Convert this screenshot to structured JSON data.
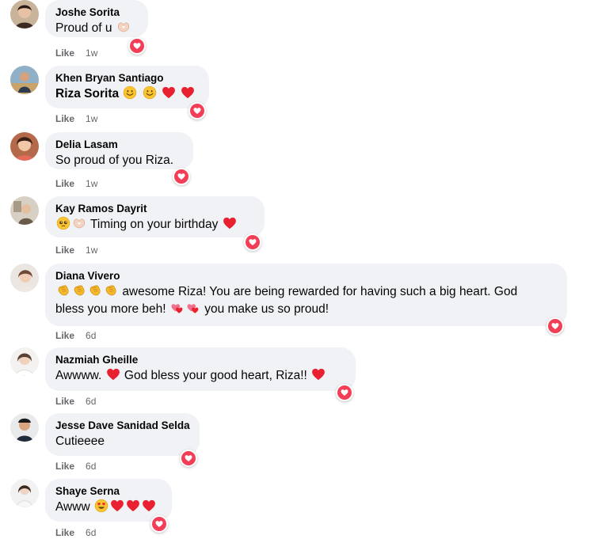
{
  "comments": [
    {
      "author": "Joshe Sorita",
      "text": "Proud of u",
      "like_label": "Like",
      "time": "1w"
    },
    {
      "author": "Khen Bryan Santiago",
      "text": "Riza Sorita",
      "like_label": "Like",
      "time": "1w"
    },
    {
      "author": "Delia Lasam",
      "text": "So proud of you Riza.",
      "like_label": "Like",
      "time": "1w"
    },
    {
      "author": "Kay Ramos Dayrit",
      "text": "Timing on your birthday",
      "like_label": "Like",
      "time": "1w"
    },
    {
      "author": "Diana Vivero",
      "text_line1": "awesome Riza! You are being rewarded for having such a big heart. God",
      "text_line2_a": "bless you more beh!",
      "text_line2_b": "you make us so proud!",
      "like_label": "Like",
      "time": "6d"
    },
    {
      "author": "Nazmiah Gheille",
      "text_a": "Awwww.",
      "text_b": "God bless your good heart, Riza!!",
      "like_label": "Like",
      "time": "6d"
    },
    {
      "author": "Jesse Dave Sanidad Selda",
      "text": "Cutieeee",
      "like_label": "Like",
      "time": "6d"
    },
    {
      "author": "Shaye Serna",
      "text": "Awww",
      "like_label": "Like",
      "time": "6d"
    }
  ],
  "icons": {
    "reaction": "heart-love-reaction-icon",
    "heart": "red-heart-emoji-icon",
    "smile": "smiling-face-emoji-icon",
    "clap": "clapping-hands-emoji-icon",
    "heart_hands": "heart-hands-emoji-icon",
    "pleading": "pleading-face-emoji-icon",
    "heart_eyes": "heart-eyes-emoji-icon",
    "hearts": "hearts-emoji-icon"
  },
  "colors": {
    "bubble": "#f0f2f5",
    "meta": "#65676b",
    "reaction": "#f33e58",
    "heart": "#e0245e"
  }
}
